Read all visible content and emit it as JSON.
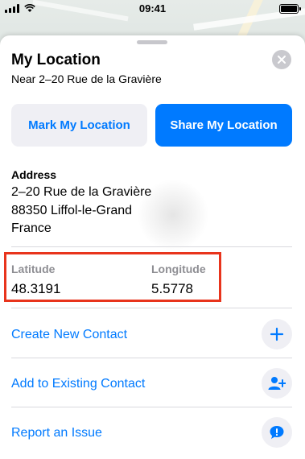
{
  "status_bar": {
    "time": "09:41"
  },
  "sheet": {
    "title": "My Location",
    "subtitle": "Near 2–20 Rue de la Gravière"
  },
  "buttons": {
    "mark_label": "Mark My Location",
    "share_label": "Share My Location"
  },
  "address": {
    "label": "Address",
    "lines": [
      "2–20 Rue de la Gravière",
      "88350 Liffol-le-Grand",
      "France"
    ]
  },
  "coordinates": {
    "latitude_label": "Latitude",
    "latitude_value": "48.3191",
    "longitude_label": "Longitude",
    "longitude_value": "5.5778"
  },
  "actions": [
    {
      "label": "Create New Contact",
      "icon": "plus-icon"
    },
    {
      "label": "Add to Existing Contact",
      "icon": "add-person-icon"
    },
    {
      "label": "Report an Issue",
      "icon": "speech-exclamation-icon"
    }
  ],
  "colors": {
    "accent": "#007aff",
    "highlight": "#e8341c"
  }
}
